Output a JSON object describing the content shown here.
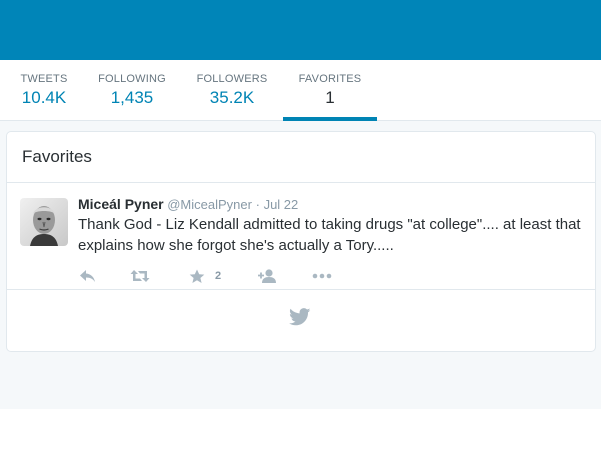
{
  "colors": {
    "banner": "#0085b8",
    "link": "#0084b4",
    "background": "#f5f8fa"
  },
  "nav": {
    "items": [
      {
        "label": "TWEETS",
        "value": "10.4K"
      },
      {
        "label": "FOLLOWING",
        "value": "1,435"
      },
      {
        "label": "FOLLOWERS",
        "value": "35.2K"
      },
      {
        "label": "FAVORITES",
        "value": "1",
        "active": true
      }
    ]
  },
  "favorites": {
    "title": "Favorites",
    "tweet": {
      "name": "Miceál Pyner",
      "handle": "@MicealPyner",
      "separator": "·",
      "date": "Jul 22",
      "text": "Thank God - Liz Kendall admitted to taking drugs \"at college\".... at least that explains how she forgot she's actually a Tory.....",
      "favorite_count": "2"
    },
    "icons": {
      "reply": "reply-icon",
      "retweet": "retweet-icon",
      "favorite": "star-icon",
      "follow": "follow-icon",
      "more": "more-icon",
      "footer": "twitter-bird-icon"
    }
  }
}
